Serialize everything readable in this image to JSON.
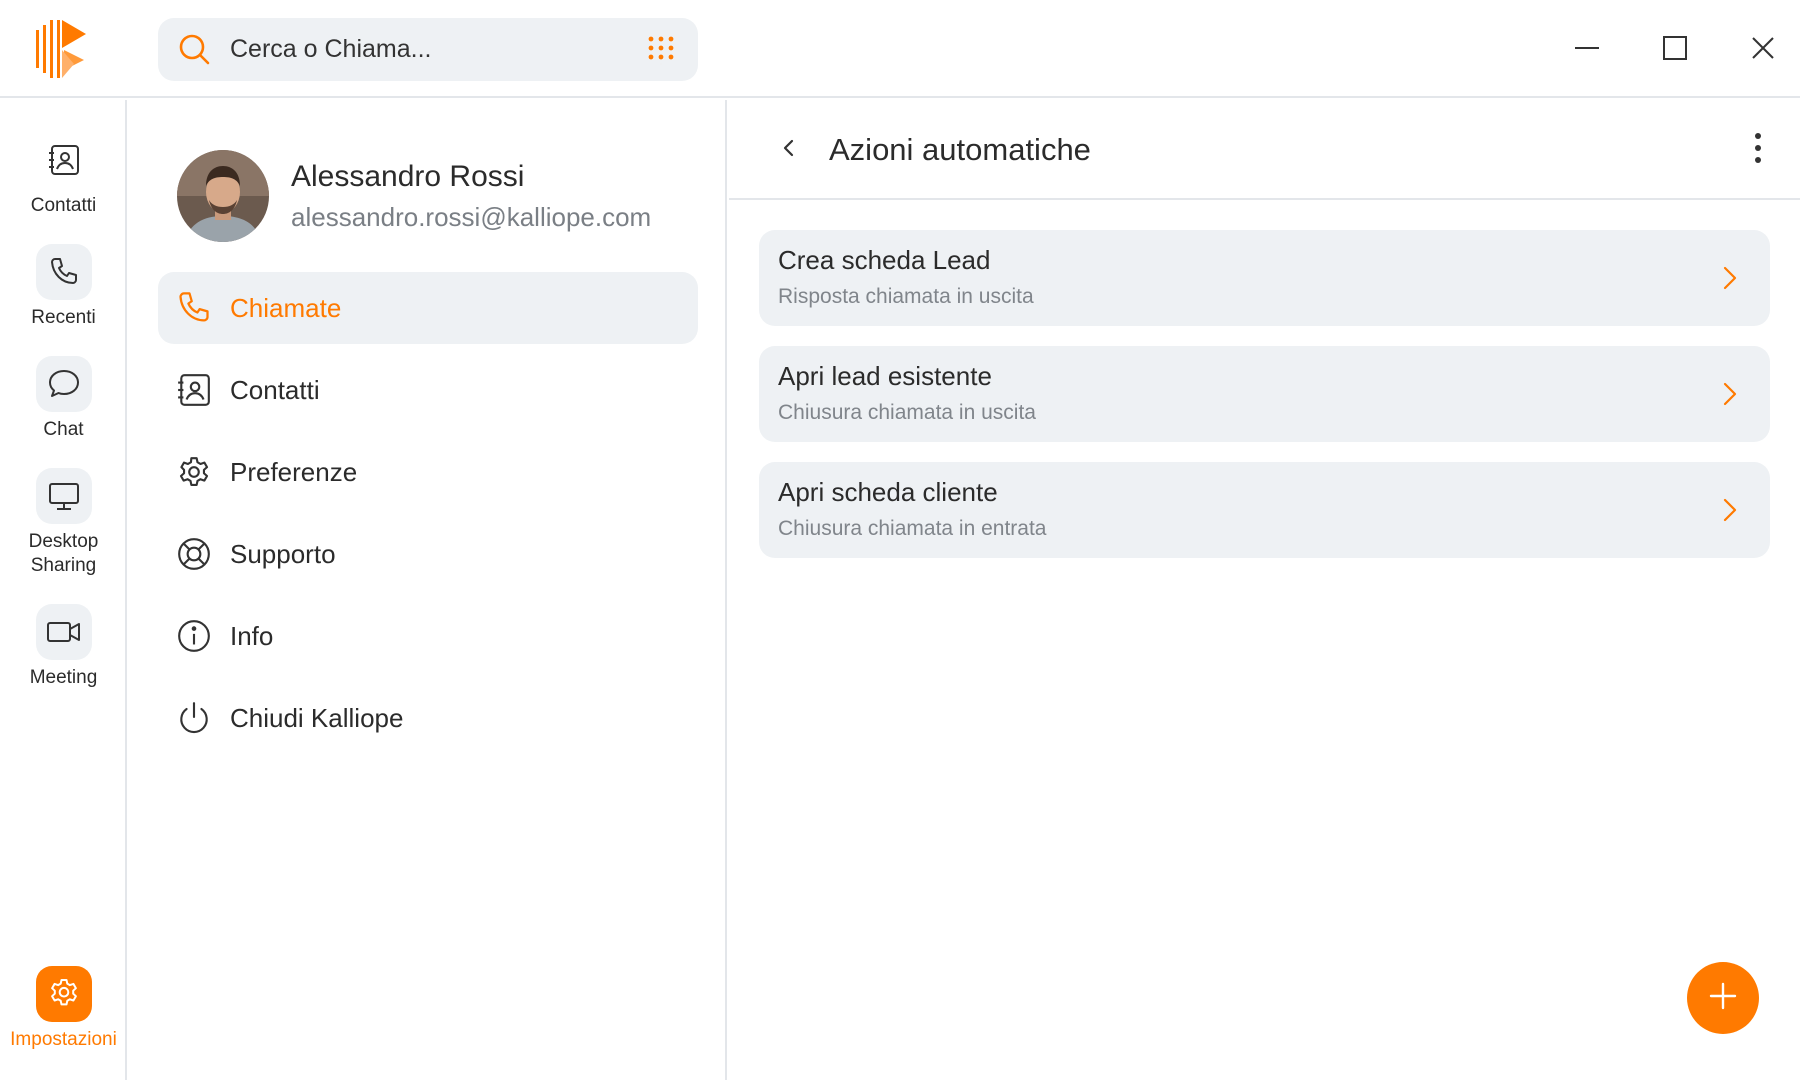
{
  "search": {
    "placeholder": "Cerca o Chiama..."
  },
  "colors": {
    "accent": "#ff7a00",
    "surface": "#eef1f4",
    "divider": "#e3e6ea"
  },
  "window_controls": {
    "icons": [
      "minimize-icon",
      "maximize-icon",
      "close-icon"
    ]
  },
  "rail": {
    "items": [
      {
        "label": "Contatti",
        "icon": "contacts-icon"
      },
      {
        "label": "Recenti",
        "icon": "phone-icon"
      },
      {
        "label": "Chat",
        "icon": "chat-bubble-icon"
      },
      {
        "label": "Desktop\nSharing",
        "icon": "monitor-icon"
      },
      {
        "label": "Meeting",
        "icon": "video-camera-icon"
      }
    ],
    "settings": {
      "label": "Impostazioni",
      "icon": "gear-icon",
      "active": true
    }
  },
  "profile": {
    "name": "Alessandro Rossi",
    "email": "alessandro.rossi@kalliope.com"
  },
  "menu": {
    "items": [
      {
        "label": "Chiamate",
        "icon": "phone-icon",
        "active": true
      },
      {
        "label": "Contatti",
        "icon": "contacts-icon"
      },
      {
        "label": "Preferenze",
        "icon": "gear-icon"
      },
      {
        "label": "Supporto",
        "icon": "lifebuoy-icon"
      },
      {
        "label": "Info",
        "icon": "info-icon"
      },
      {
        "label": "Chiudi Kalliope",
        "icon": "power-icon"
      }
    ]
  },
  "panel": {
    "title": "Azioni automatiche",
    "actions": [
      {
        "title": "Crea scheda Lead",
        "subtitle": "Risposta chiamata in uscita"
      },
      {
        "title": "Apri lead esistente",
        "subtitle": "Chiusura chiamata in uscita"
      },
      {
        "title": "Apri scheda cliente",
        "subtitle": "Chiusura chiamata in entrata"
      }
    ],
    "fab_icon": "plus-icon"
  }
}
